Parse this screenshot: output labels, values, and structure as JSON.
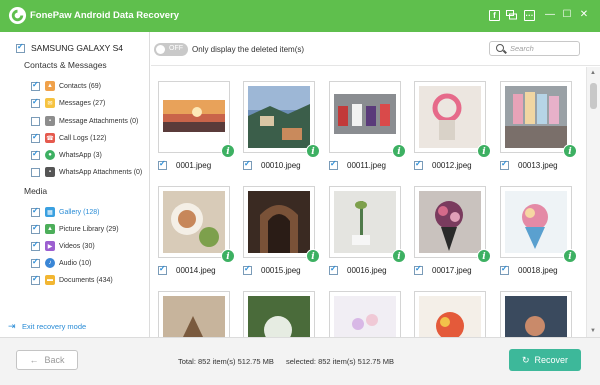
{
  "window": {
    "title": "FonePaw Android Data Recovery",
    "icons": [
      "facebook-icon",
      "feedback-icon",
      "chat-icon",
      "minimize-icon",
      "maximize-icon",
      "close-icon"
    ]
  },
  "sidebar": {
    "device": "SAMSUNG GALAXY S4",
    "sections": [
      {
        "title": "Contacts & Messages",
        "items": [
          {
            "label": "Contacts (69)",
            "icon": "contacts-icon",
            "color": "#f0a14a"
          },
          {
            "label": "Messages (27)",
            "icon": "messages-icon",
            "color": "#f6c341"
          },
          {
            "label": "Message Attachments (0)",
            "icon": "attachment-icon",
            "color": "#8d8d8d"
          },
          {
            "label": "Call Logs (122)",
            "icon": "call-logs-icon",
            "color": "#e55a4e"
          },
          {
            "label": "WhatsApp (3)",
            "icon": "whatsapp-icon",
            "color": "#3db062"
          },
          {
            "label": "WhatsApp Attachments (0)",
            "icon": "whatsapp-attachment-icon",
            "color": "#555555"
          }
        ]
      },
      {
        "title": "Media",
        "items": [
          {
            "label": "Gallery (128)",
            "icon": "gallery-icon",
            "color": "#3aa0e0",
            "active": true
          },
          {
            "label": "Picture Library (29)",
            "icon": "picture-library-icon",
            "color": "#4cae5a"
          },
          {
            "label": "Videos (30)",
            "icon": "videos-icon",
            "color": "#9c5fd0"
          },
          {
            "label": "Audio (10)",
            "icon": "audio-icon",
            "color": "#3a86d6"
          },
          {
            "label": "Documents (434)",
            "icon": "documents-icon",
            "color": "#f2b632"
          }
        ]
      }
    ],
    "exit_label": "Exit recovery mode"
  },
  "filter": {
    "toggle_text": "OFF",
    "label": "Only display the deleted item(s)",
    "search_placeholder": "Search"
  },
  "grid": {
    "items": [
      {
        "name": "0001.jpeg",
        "checked": true
      },
      {
        "name": "00010.jpeg",
        "checked": true
      },
      {
        "name": "00011.jpeg",
        "checked": true
      },
      {
        "name": "00012.jpeg",
        "checked": true
      },
      {
        "name": "00013.jpeg",
        "checked": true
      },
      {
        "name": "00014.jpeg",
        "checked": true
      },
      {
        "name": "00015.jpeg",
        "checked": true
      },
      {
        "name": "00016.jpeg",
        "checked": true
      },
      {
        "name": "00017.jpeg",
        "checked": true
      },
      {
        "name": "00018.jpeg",
        "checked": true
      },
      {
        "name": "",
        "checked": true
      },
      {
        "name": "",
        "checked": true
      },
      {
        "name": "",
        "checked": true
      },
      {
        "name": "",
        "checked": true
      },
      {
        "name": "",
        "checked": true
      }
    ]
  },
  "footer": {
    "back_label": "Back",
    "total": "Total: 852 item(s) 512.75 MB",
    "selected": "selected: 852 item(s) 512.75 MB",
    "recover_label": "Recover"
  },
  "colors": {
    "titlebar": "#5fbf4d",
    "accent_blue": "#2a8cd6",
    "recover": "#3db89a",
    "info_badge": "#3db062"
  }
}
